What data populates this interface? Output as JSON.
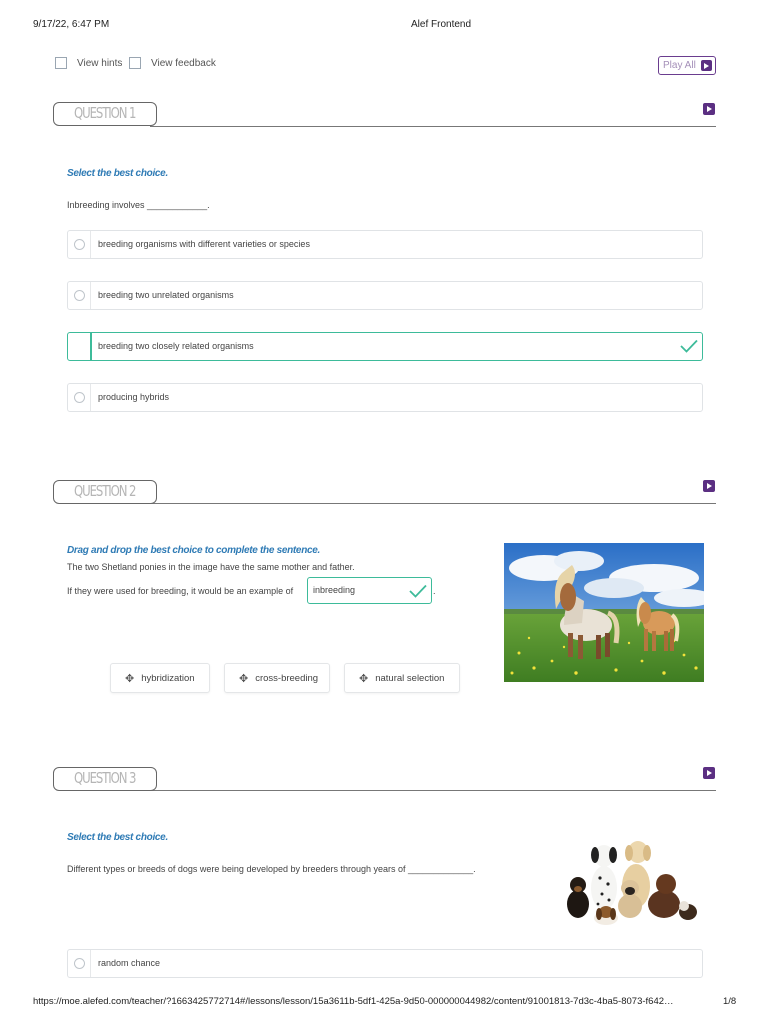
{
  "print_header": {
    "datetime": "9/17/22, 6:47 PM",
    "title": "Alef Frontend"
  },
  "toolbar": {
    "view_hints": "View hints",
    "view_feedback": "View feedback",
    "play_all": "Play All"
  },
  "questions": [
    {
      "tab": "QUESTION 1",
      "instruction": "Select the best choice.",
      "prompt": "Inbreeding involves ____________.",
      "options": [
        {
          "label": "breeding organisms with different varieties or species",
          "selected": false
        },
        {
          "label": "breeding two unrelated organisms",
          "selected": false
        },
        {
          "label": "breeding two closely related organisms",
          "selected": true
        },
        {
          "label": "producing hybrids",
          "selected": false
        }
      ]
    },
    {
      "tab": "QUESTION 2",
      "instruction": "Drag and drop the best choice to complete the sentence.",
      "line1": "The two Shetland ponies in the image have the same mother and father.",
      "line2": "If they were used for breeding, it would be an example of",
      "line2_end": ".",
      "answer": "inbreeding",
      "choices": [
        "hybridization",
        "cross-breeding",
        "natural selection"
      ]
    },
    {
      "tab": "QUESTION 3",
      "instruction": "Select the best choice.",
      "prompt": "Different types or breeds of dogs were being developed by breeders through years of _____________.",
      "options": [
        {
          "label": "random chance",
          "selected": false
        }
      ]
    }
  ],
  "print_footer": {
    "url": "https://moe.alefed.com/teacher/?1663425772714#/lessons/lesson/15a3611b-5df1-425a-9d50-000000044982/content/91001813-7d3c-4ba5-8073-f642…",
    "page": "1/8"
  },
  "colors": {
    "accent_teal": "#3dbb9a",
    "instruction_blue": "#2f7bb5",
    "play_purple": "#5b2f82"
  },
  "icons": [
    "play-icon",
    "move-icon",
    "checkmark-icon",
    "radio-icon",
    "checkbox-icon"
  ]
}
